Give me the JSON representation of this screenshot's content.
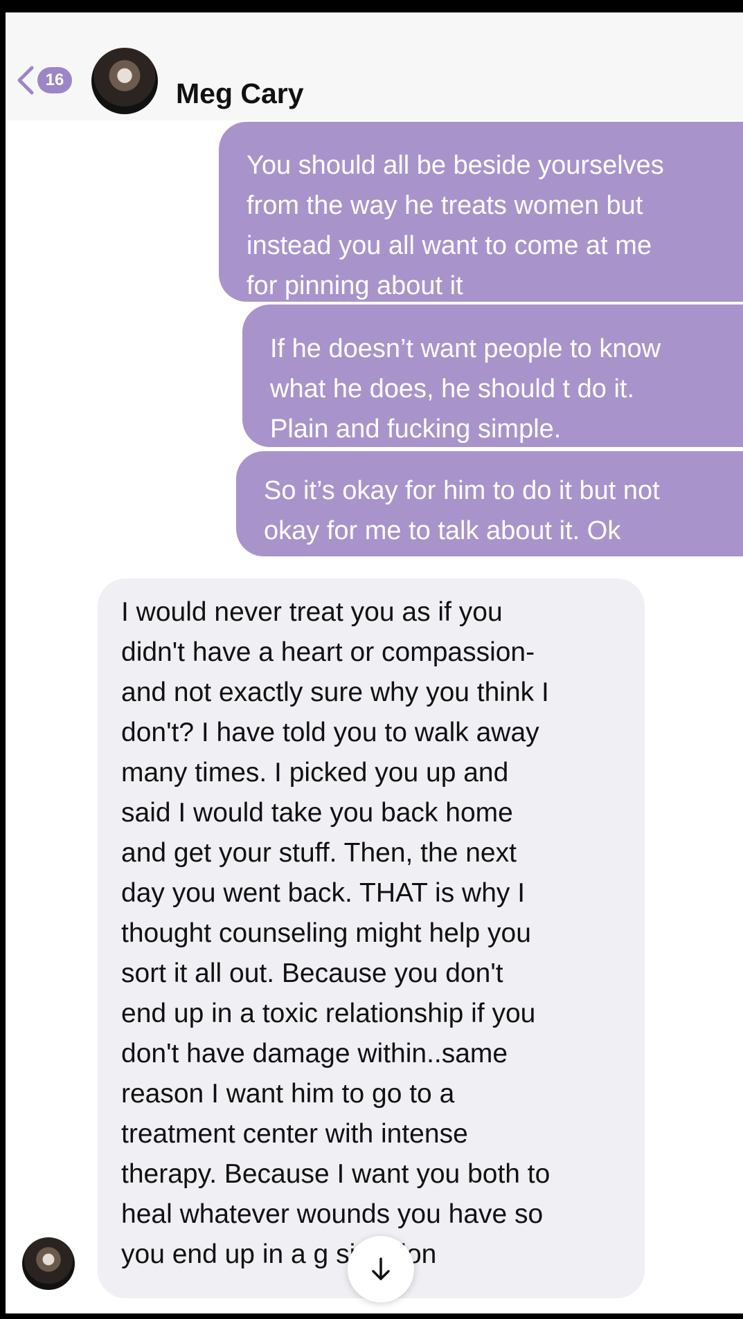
{
  "header": {
    "back_badge": "16",
    "contact_name": "Meg Cary"
  },
  "messages": [
    {
      "direction": "sent",
      "text": "You should all be beside yourselves\nfrom the way he treats women but\ninstead you all want to come at me\nfor pinning about it"
    },
    {
      "direction": "sent",
      "text": "If he doesn’t want people to know\nwhat he does, he should t do it.\nPlain and fucking simple."
    },
    {
      "direction": "sent",
      "text": "So it’s okay for him to do it but not\nokay for me to talk about it. Ok"
    },
    {
      "direction": "received",
      "text": "I would never treat you as if you\ndidn't have a heart or compassion-\nand not exactly sure why you think I\ndon't? I have told you to walk away\nmany times. I picked you up and\nsaid I would take you back home\nand get your stuff. Then, the next\nday you went back. THAT is why I\nthought counseling might help you\nsort it all out. Because you don't\nend up in a toxic relationship if you\ndon't have damage within..same\nreason I want him to go to a\ntreatment center with intense\ntherapy. Because I want you both to\nheal whatever wounds you have so\nyou end up in a g      situation"
    }
  ],
  "icons": {
    "back": "chevron-left-icon",
    "scroll_down": "arrow-down-icon"
  },
  "colors": {
    "sent_bubble": "#a894cb",
    "received_bubble": "#f0eff4",
    "accent": "#9c86c6"
  }
}
